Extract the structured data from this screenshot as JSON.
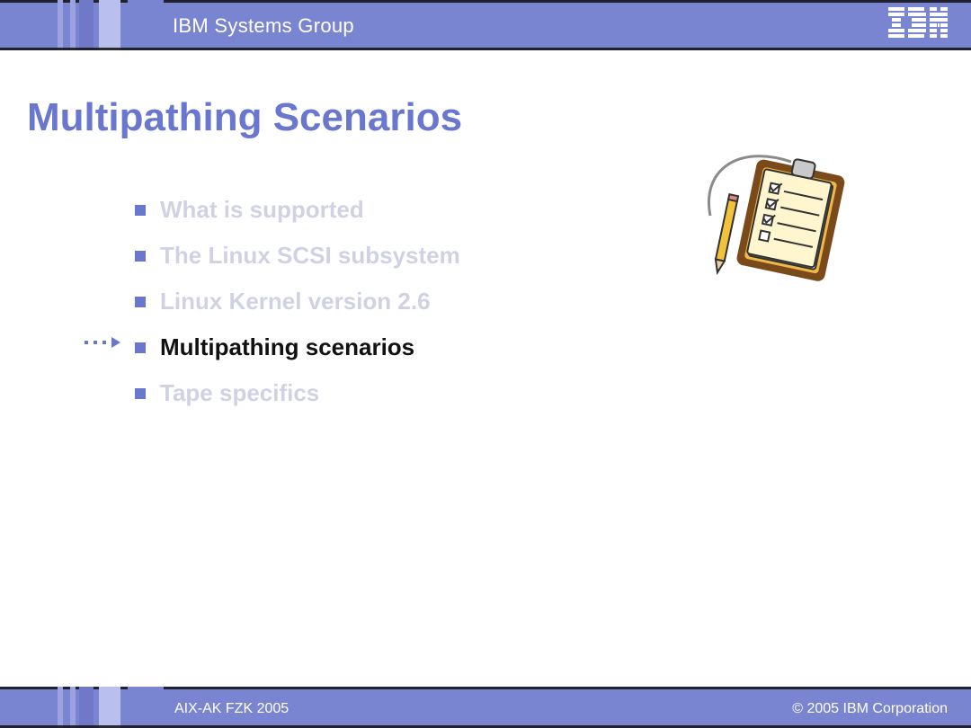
{
  "header": {
    "group": "IBM Systems Group"
  },
  "title": "Multipathing Scenarios",
  "agenda": {
    "items": [
      {
        "label": "What is supported",
        "active": false
      },
      {
        "label": "The Linux SCSI subsystem",
        "active": false
      },
      {
        "label": "Linux Kernel version 2.6",
        "active": false
      },
      {
        "label": "Multipathing scenarios",
        "active": true
      },
      {
        "label": "Tape specifics",
        "active": false
      }
    ]
  },
  "footer": {
    "left": "AIX-AK FZK 2005",
    "right": "© 2005 IBM Corporation"
  }
}
